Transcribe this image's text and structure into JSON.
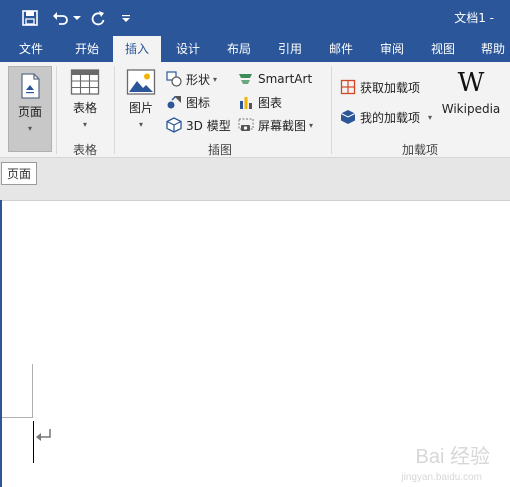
{
  "title_bar": {
    "document_title": "文档1 -",
    "quick_access": [
      "save-icon",
      "undo-icon",
      "redo-icon",
      "customize-qat-icon"
    ]
  },
  "tabs": [
    "文件",
    "开始",
    "插入",
    "设计",
    "布局",
    "引用",
    "邮件",
    "审阅",
    "视图",
    "帮助"
  ],
  "active_tab": "插入",
  "ribbon": {
    "pages": {
      "label": "页面",
      "tooltip": "页面"
    },
    "tables": {
      "label": "表格",
      "group": "表格"
    },
    "illustrations": {
      "group": "插图",
      "picture": "图片",
      "shapes": "形状",
      "icons": "图标",
      "model3d": "3D 模型",
      "smartart": "SmartArt",
      "chart": "图表",
      "screenshot": "屏幕截图"
    },
    "addins": {
      "group": "加载项",
      "get_addins": "获取加载项",
      "my_addins": "我的加载项",
      "wikipedia": "Wikipedia",
      "wikipedia_logo": "W"
    }
  },
  "watermark": {
    "text": "Bai 经验",
    "sub": "jingyan.baidu.com"
  },
  "colors": {
    "brand": "#2b579a",
    "ribbon_bg": "#f3f3f3",
    "workspace": "#e6e6e6"
  }
}
